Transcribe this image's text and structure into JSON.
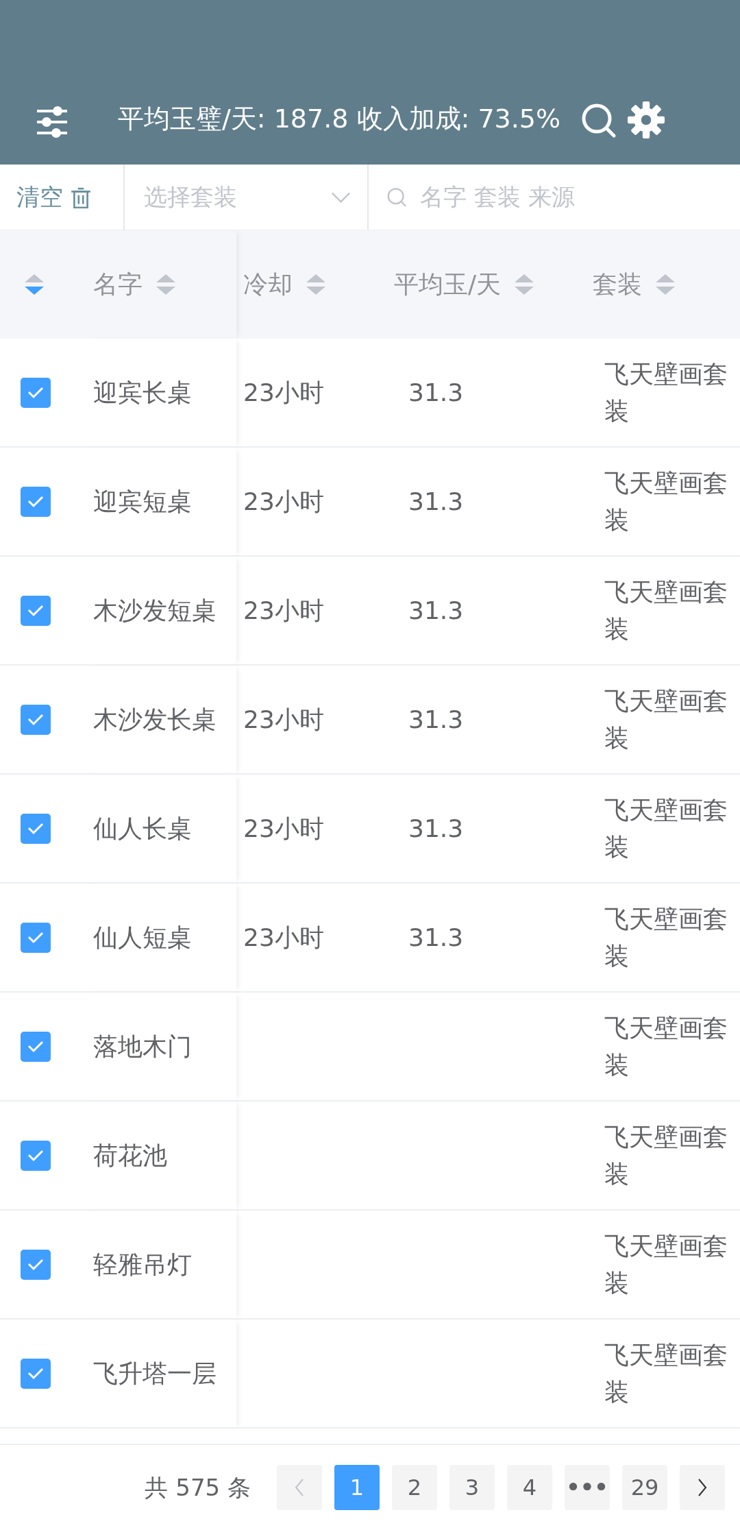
{
  "header": {
    "title": "平均玉璧/天: 187.8 收入加成: 73.5%"
  },
  "toolbar": {
    "clear_label": "清空",
    "set_select": {
      "placeholder": "选择套装"
    },
    "search": {
      "placeholder": "名字 套装 来源"
    }
  },
  "table": {
    "columns": [
      {
        "sorted_descending": true
      },
      {
        "label": "名字",
        "sorted_descending": false
      },
      {
        "label": "冷却",
        "sorted_descending": false
      },
      {
        "label": "平均玉/天",
        "sorted_descending": false
      },
      {
        "label": "套装",
        "sorted_descending": false
      }
    ],
    "rows": [
      {
        "checked": true,
        "name": "迎宾长桌",
        "cooldown": "23小时",
        "avg": "31.3",
        "set": "飞天壁画套装"
      },
      {
        "checked": true,
        "name": "迎宾短桌",
        "cooldown": "23小时",
        "avg": "31.3",
        "set": "飞天壁画套装"
      },
      {
        "checked": true,
        "name": "木沙发短桌",
        "cooldown": "23小时",
        "avg": "31.3",
        "set": "飞天壁画套装"
      },
      {
        "checked": true,
        "name": "木沙发长桌",
        "cooldown": "23小时",
        "avg": "31.3",
        "set": "飞天壁画套装"
      },
      {
        "checked": true,
        "name": "仙人长桌",
        "cooldown": "23小时",
        "avg": "31.3",
        "set": "飞天壁画套装"
      },
      {
        "checked": true,
        "name": "仙人短桌",
        "cooldown": "23小时",
        "avg": "31.3",
        "set": "飞天壁画套装"
      },
      {
        "checked": true,
        "name": "落地木门",
        "set": "飞天壁画套装"
      },
      {
        "checked": true,
        "name": "荷花池",
        "set": "飞天壁画套装"
      },
      {
        "checked": true,
        "name": "轻雅吊灯",
        "set": "飞天壁画套装"
      },
      {
        "checked": true,
        "name": "飞升塔一层",
        "set": "飞天壁画套装"
      }
    ]
  },
  "pagination": {
    "total": "共 575 条",
    "prev_disabled": true,
    "next_disabled": false,
    "pages": [
      {
        "label": "1",
        "kind": "page",
        "selected": true
      },
      {
        "label": "2",
        "kind": "page",
        "selected": false
      },
      {
        "label": "3",
        "kind": "page",
        "selected": false
      },
      {
        "label": "4",
        "kind": "page",
        "selected": false
      },
      {
        "label": "•••",
        "kind": "more",
        "selected": false
      },
      {
        "label": "29",
        "kind": "page",
        "selected": false
      }
    ]
  }
}
